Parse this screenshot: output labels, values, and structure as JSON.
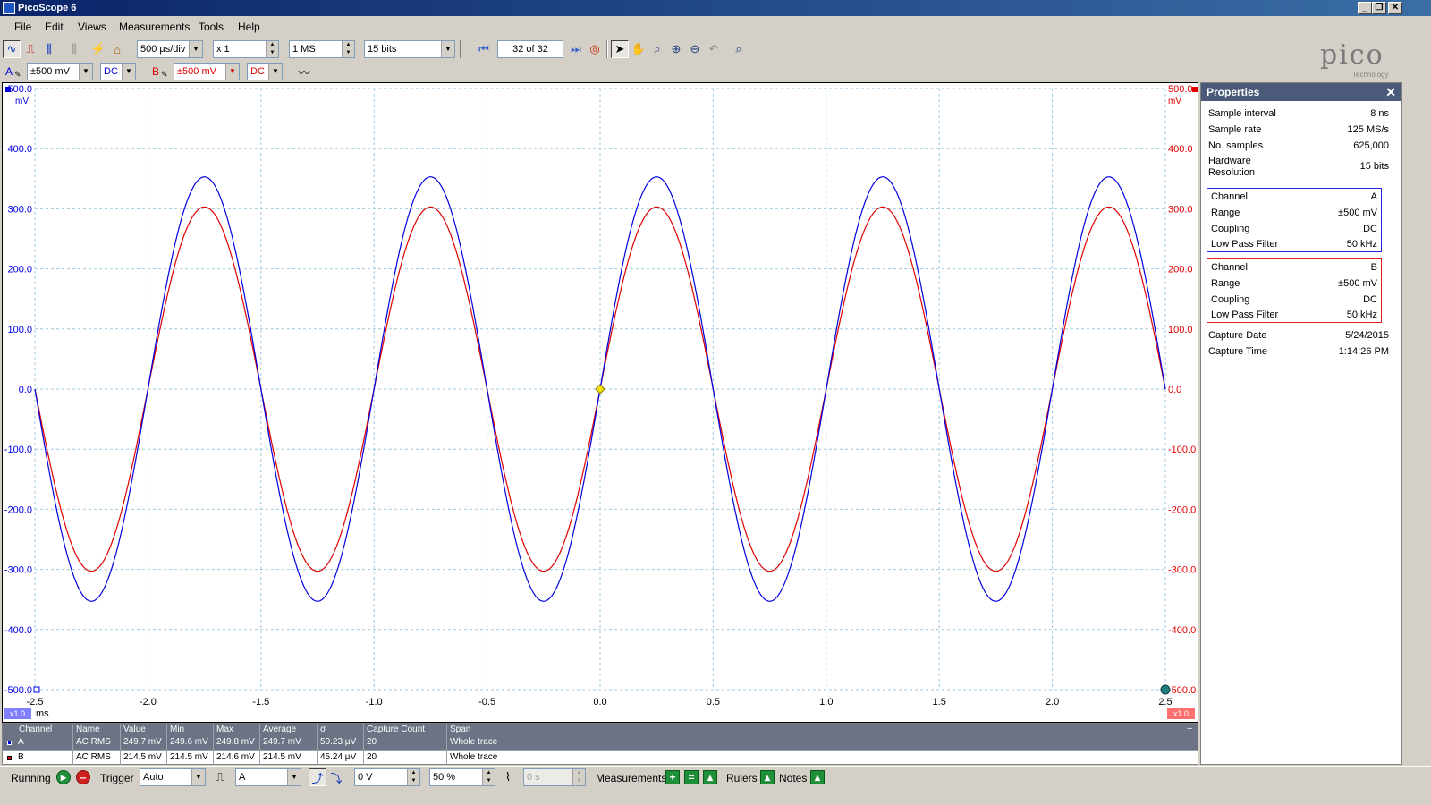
{
  "window": {
    "title": "PicoScope 6"
  },
  "menu": [
    "File",
    "Edit",
    "Views",
    "Measurements",
    "Tools",
    "Help"
  ],
  "toolbar": {
    "timebase": "500 µs/div",
    "zoom": "x 1",
    "samples": "1 MS",
    "resolution": "15 bits",
    "buffer": "32 of 32"
  },
  "channels": {
    "a": {
      "label": "A",
      "range": "±500 mV",
      "coupling": "DC",
      "color": "#0000e0"
    },
    "b": {
      "label": "B",
      "range": "±500 mV",
      "coupling": "DC",
      "color": "#e00000"
    }
  },
  "chart_data": {
    "type": "line",
    "xlabel": "ms",
    "x_ticks": [
      "-2.5",
      "-2.0",
      "-1.5",
      "-1.0",
      "-0.5",
      "0.0",
      "0.5",
      "1.0",
      "1.5",
      "2.0",
      "2.5"
    ],
    "xlim": [
      -2.5,
      2.5
    ],
    "ylim": [
      -500,
      500
    ],
    "y_ticks_left": [
      "500.0",
      "400.0",
      "300.0",
      "200.0",
      "100.0",
      "0.0",
      "-100.0",
      "-200.0",
      "-300.0",
      "-400.0",
      "-500.0"
    ],
    "y_ticks_right": [
      "500.0",
      "400.0",
      "300.0",
      "200.0",
      "100.0",
      "0.0",
      "-100.0",
      "-200.0",
      "-300.0",
      "-400.0",
      "-500.0"
    ],
    "yunit_left": "mV",
    "yunit_right": "mV",
    "x_scale_badge": "x1.0",
    "grid": true,
    "series": [
      {
        "name": "A",
        "amplitude_mV": 353,
        "frequency_kHz": 1.0,
        "color": "#0000e0"
      },
      {
        "name": "B",
        "amplitude_mV": 303,
        "frequency_kHz": 1.0,
        "color": "#e00000"
      }
    ]
  },
  "properties": {
    "title": "Properties",
    "rows": [
      {
        "k": "Sample interval",
        "v": "8 ns"
      },
      {
        "k": "Sample rate",
        "v": "125 MS/s"
      },
      {
        "k": "No. samples",
        "v": "625,000"
      },
      {
        "k": "Hardware Resolution",
        "v": "15 bits"
      }
    ],
    "channel_a": [
      {
        "k": "Channel",
        "v": "A"
      },
      {
        "k": "Range",
        "v": "±500 mV"
      },
      {
        "k": "Coupling",
        "v": "DC"
      },
      {
        "k": "Low Pass Filter",
        "v": "50 kHz"
      }
    ],
    "channel_b": [
      {
        "k": "Channel",
        "v": "B"
      },
      {
        "k": "Range",
        "v": "±500 mV"
      },
      {
        "k": "Coupling",
        "v": "DC"
      },
      {
        "k": "Low Pass Filter",
        "v": "50 kHz"
      }
    ],
    "capture": [
      {
        "k": "Capture Date",
        "v": "5/24/2015"
      },
      {
        "k": "Capture Time",
        "v": "1:14:26 PM"
      }
    ]
  },
  "measurements": {
    "headers": [
      "Channel",
      "Name",
      "Value",
      "Min",
      "Max",
      "Average",
      "σ",
      "Capture Count",
      "Span"
    ],
    "rows": [
      [
        "A",
        "AC RMS",
        "249.7 mV",
        "249.6 mV",
        "249.8 mV",
        "249.7 mV",
        "50.23 µV",
        "20",
        "Whole trace"
      ],
      [
        "B",
        "AC RMS",
        "214.5 mV",
        "214.5 mV",
        "214.6 mV",
        "214.5 mV",
        "45.24 µV",
        "20",
        "Whole trace"
      ]
    ]
  },
  "status": {
    "running": "Running",
    "trigger_label": "Trigger",
    "trigger_mode": "Auto",
    "trigger_source": "A",
    "trigger_level": "0 V",
    "pretrigger": "50 %",
    "delay": "0 s",
    "measurements_label": "Measurements",
    "rulers_label": "Rulers",
    "notes_label": "Notes"
  },
  "logo": {
    "text": "pico",
    "sub": "Technology"
  }
}
